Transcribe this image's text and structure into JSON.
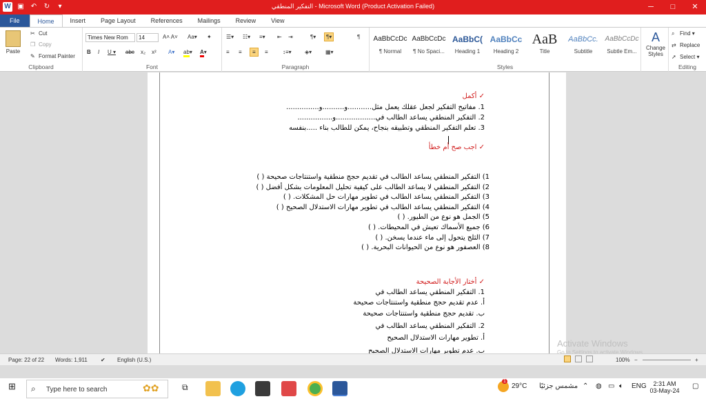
{
  "titlebar": {
    "title": "التفكير المنطقي - Microsoft Word (Product Activation Failed)"
  },
  "tabs": [
    "File",
    "Home",
    "Insert",
    "Page Layout",
    "References",
    "Mailings",
    "Review",
    "View"
  ],
  "clipboard": {
    "paste": "Paste",
    "cut": "Cut",
    "copy": "Copy",
    "format_painter": "Format Painter",
    "label": "Clipboard"
  },
  "font": {
    "name": "Times New Rom",
    "size": "14",
    "label": "Font"
  },
  "paragraph": {
    "label": "Paragraph"
  },
  "styles": {
    "items": [
      {
        "preview": "AaBbCcDc",
        "name": "¶ Normal"
      },
      {
        "preview": "AaBbCcDc",
        "name": "¶ No Spaci..."
      },
      {
        "preview": "AaBbC(",
        "name": "Heading 1"
      },
      {
        "preview": "AaBbCc",
        "name": "Heading 2"
      },
      {
        "preview": "AaB",
        "name": "Title"
      },
      {
        "preview": "AaBbCc.",
        "name": "Subtitle"
      },
      {
        "preview": "AaBbCcDc",
        "name": "Subtle Em..."
      }
    ],
    "change": "Change Styles",
    "label": "Styles"
  },
  "editing": {
    "find": "Find",
    "replace": "Replace",
    "select": "Select",
    "label": "Editing"
  },
  "document": {
    "h1": "✓ أكمل",
    "fill": [
      "1.   مفاتيح التفكير لجعل عقلك يعمل مثل...........و..........و...............",
      "2.   التفكير المنطقي يساعد الطالب في..................و................",
      "3.   تعلم التفكير المنطقي وتطبيقه بنجاح، يمكن للطالب بناء .....بنفسه"
    ],
    "h2": "✓ اجب صح أم خطأ",
    "tf": [
      "1) التفكير المنطقي  يساعد الطالب في تقديم حجج منطقية واستنتاجات صحيحة (          )",
      "2) التفكير المنطقي  لا يساعد الطالب  على كيفية تحليل المعلومات بشكل أفضل (          )",
      "3) التفكير المنطقي يساعد الطالب في تطوير مهارات حل المشكلات. (          )",
      "4) التفكير المنطقي يساعد الطالب في تطوير مهارات الاستدلال الصحيح (          )",
      "5) الجمل هو نوع من الطيور. (          )",
      "6) جميع الأسماك تعيش في المحيطات. (          )",
      "7) الثلج يتحول إلى ماء عندما يسخن. (          )",
      "8) العصفور هو نوع من الحيوانات البحرية. (          )"
    ],
    "h3": "✓ أختار الأجابة الصحيحة",
    "mc": [
      "1.  التفكير المنطقي يساعد الطالب في",
      "أ.   عدم تقديم حجج منطقية واستنتاجات صحيحة",
      "ب.  تقديم حجج منطقية واستنتاجات صحيحة",
      "2.  التفكير المنطقي يساعد الطالب في",
      "أ.   تطوير مهارات الاستدلال الصحيح",
      "ب.  عدم تطوير مهارات الاستدلال الصحيح"
    ]
  },
  "watermark": {
    "line1": "Activate Windows",
    "line2": "Go to Settings to activate Windows."
  },
  "status": {
    "page": "Page: 22 of 22",
    "words": "Words: 1,911",
    "lang": "English (U.S.)",
    "zoom": "100%"
  },
  "taskbar": {
    "search": "Type here to search",
    "temp": "29°C",
    "weather": "مشمس جزئيًا",
    "lang": "ENG",
    "time": "2:31 AM",
    "date": "03-May-24",
    "badge": "1"
  }
}
